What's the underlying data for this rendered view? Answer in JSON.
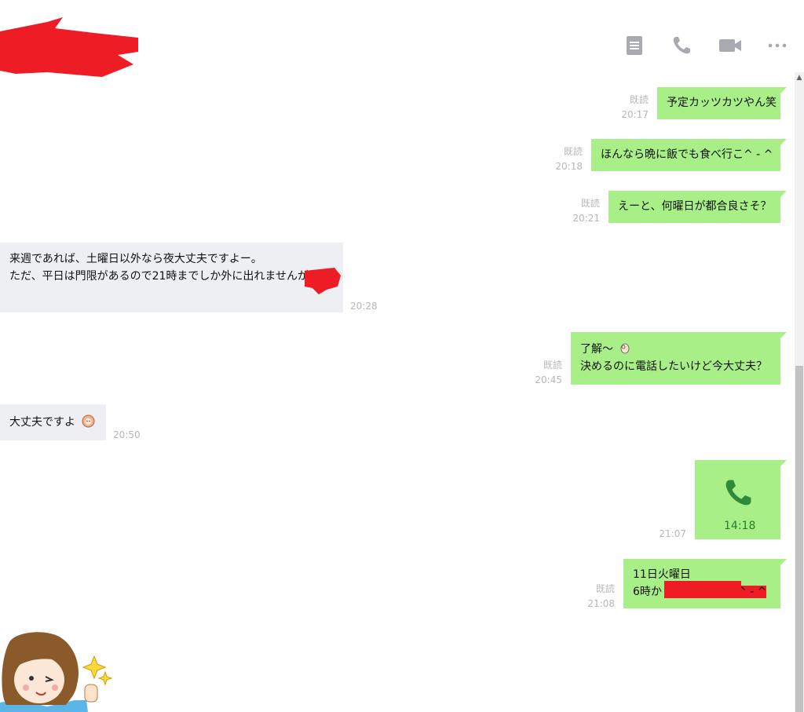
{
  "header": {
    "icons": [
      "notes-icon",
      "phone-icon",
      "video-icon",
      "more-icon"
    ]
  },
  "messages": [
    {
      "side": "mine",
      "lines": [
        "予定カッツカツやん笑"
      ],
      "read": "既読",
      "time": "20:17"
    },
    {
      "side": "mine",
      "lines": [
        "ほんなら晩に飯でも食べ行こ^ - ^"
      ],
      "read": "既読",
      "time": "20:18"
    },
    {
      "side": "mine",
      "lines": [
        "えーと、何曜日が都合良さそ？"
      ],
      "read": "既読",
      "time": "20:21"
    },
    {
      "side": "theirs",
      "lines": [
        "来週であれば、土曜日以外なら夜大丈夫ですよー。",
        "ただ、平日は門限があるので21時までしか外に出れませんが"
      ],
      "time": "20:28"
    },
    {
      "side": "mine",
      "lines": [
        "了解〜",
        "決めるのに電話したいけど今大丈夫？"
      ],
      "read": "既読",
      "time": "20:45"
    },
    {
      "side": "theirs",
      "lines": [
        "大丈夫ですよ"
      ],
      "time": "20:50"
    },
    {
      "side": "mine",
      "type": "call",
      "duration": "14:18",
      "time": "21:07"
    },
    {
      "side": "mine",
      "lines": [
        "11日火曜日",
        "6時か",
        "^ - ^"
      ],
      "read": "既読",
      "time": "21:08"
    }
  ],
  "colors": {
    "mine_bubble": "#a8ef88",
    "theirs_bubble": "#eeeff3",
    "redaction": "#ee1c24",
    "icon": "#a9aab1"
  }
}
